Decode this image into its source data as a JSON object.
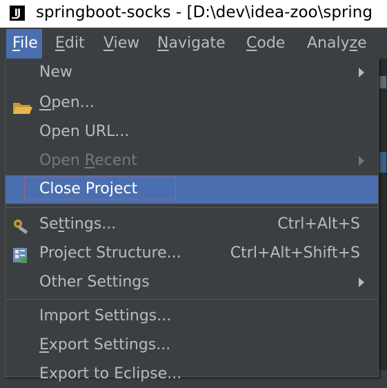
{
  "window": {
    "logo": "IJ",
    "title": "springboot-socks - [D:\\dev\\idea-zoo\\spring"
  },
  "menubar": {
    "items": [
      {
        "label": "File",
        "mnemonic": "F"
      },
      {
        "label": "Edit",
        "mnemonic": "E"
      },
      {
        "label": "View",
        "mnemonic": "V"
      },
      {
        "label": "Navigate",
        "mnemonic": "N"
      },
      {
        "label": "Code",
        "mnemonic": "C"
      },
      {
        "label": "Analyze",
        "mnemonic": "z"
      }
    ]
  },
  "file_menu": {
    "items": [
      {
        "label": "New",
        "submenu": true
      },
      {
        "label": "Open...",
        "icon": "folder-open-icon"
      },
      {
        "label": "Open URL..."
      },
      {
        "label": "Open Recent",
        "submenu": true,
        "disabled": true
      },
      {
        "label": "Close Project",
        "selected": true
      },
      {
        "label": "Settings...",
        "shortcut": "Ctrl+Alt+S",
        "icon": "settings-wrench-icon"
      },
      {
        "label": "Project Structure...",
        "shortcut": "Ctrl+Alt+Shift+S",
        "icon": "project-structure-icon"
      },
      {
        "label": "Other Settings",
        "submenu": true
      },
      {
        "label": "Import Settings..."
      },
      {
        "label": "Export Settings..."
      },
      {
        "label": "Export to Eclipse..."
      }
    ]
  },
  "colors": {
    "menu_bg": "#3c3f41",
    "selection": "#4b6eaf",
    "text": "#bbbbbb",
    "disabled_text": "#777777"
  }
}
